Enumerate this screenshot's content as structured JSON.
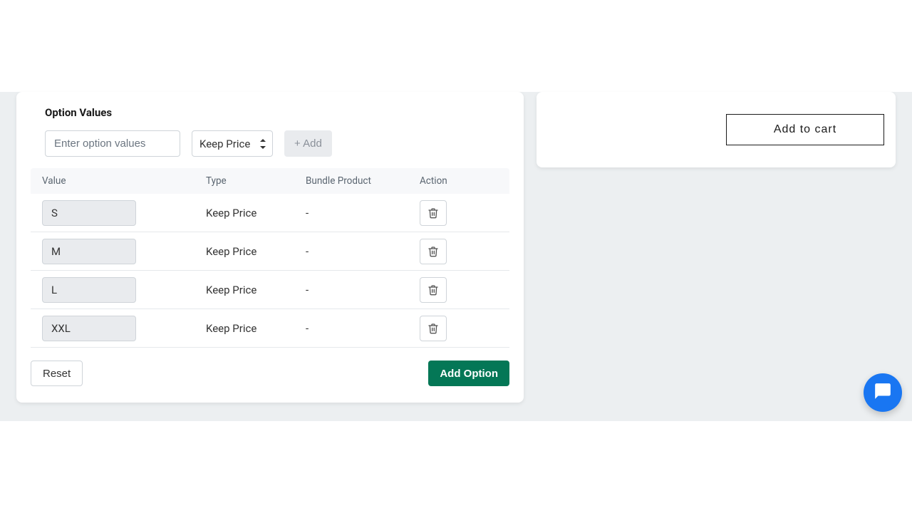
{
  "section_title": "Option Values",
  "input": {
    "placeholder": "Enter option values",
    "value": ""
  },
  "price_select": {
    "selected": "Keep Price"
  },
  "add_value_label": "+ Add",
  "table": {
    "headers": {
      "value": "Value",
      "type": "Type",
      "bundle": "Bundle Product",
      "action": "Action"
    },
    "rows": [
      {
        "value": "S",
        "type": "Keep Price",
        "bundle": "-"
      },
      {
        "value": "M",
        "type": "Keep Price",
        "bundle": "-"
      },
      {
        "value": "L",
        "type": "Keep Price",
        "bundle": "-"
      },
      {
        "value": "XXL",
        "type": "Keep Price",
        "bundle": "-"
      }
    ]
  },
  "footer": {
    "reset": "Reset",
    "add_option": "Add Option"
  },
  "preview": {
    "add_to_cart": "Add to cart"
  }
}
